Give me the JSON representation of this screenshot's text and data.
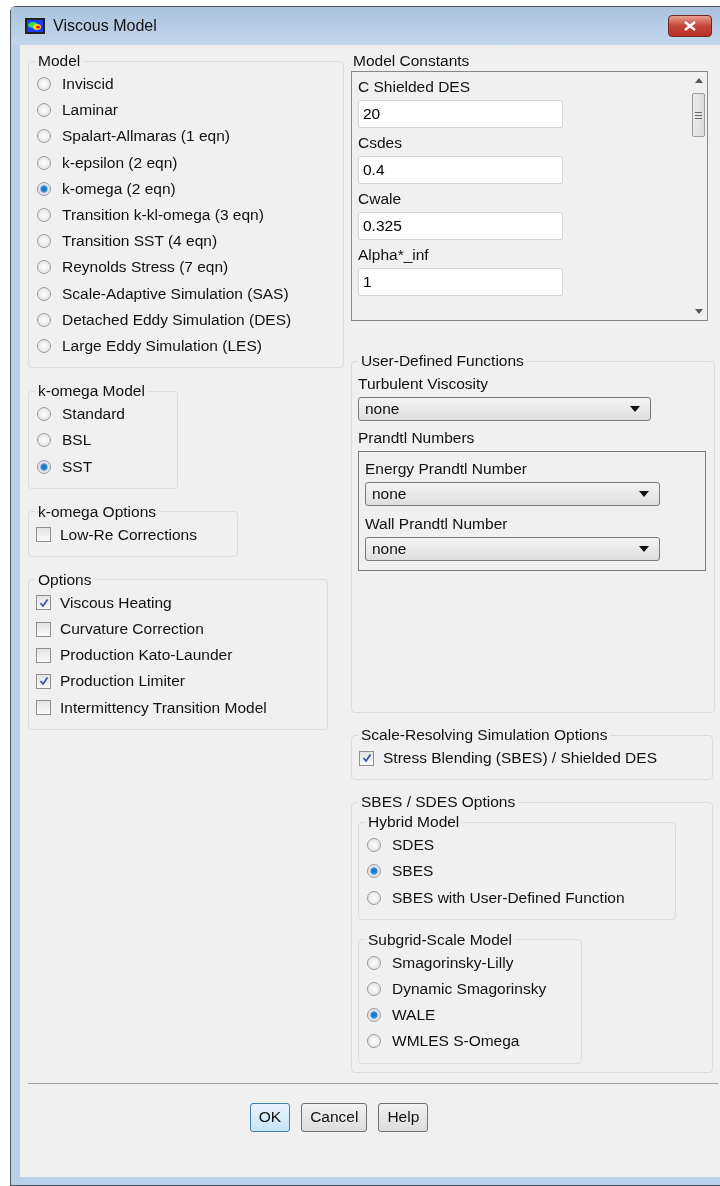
{
  "window": {
    "title": "Viscous Model"
  },
  "model": {
    "title": "Model",
    "options": [
      {
        "label": "Inviscid",
        "selected": false
      },
      {
        "label": "Laminar",
        "selected": false
      },
      {
        "label": "Spalart-Allmaras (1 eqn)",
        "selected": false
      },
      {
        "label": "k-epsilon (2 eqn)",
        "selected": false
      },
      {
        "label": "k-omega (2 eqn)",
        "selected": true
      },
      {
        "label": "Transition k-kl-omega (3 eqn)",
        "selected": false
      },
      {
        "label": "Transition SST (4 eqn)",
        "selected": false
      },
      {
        "label": "Reynolds Stress (7 eqn)",
        "selected": false
      },
      {
        "label": "Scale-Adaptive Simulation (SAS)",
        "selected": false
      },
      {
        "label": "Detached Eddy Simulation (DES)",
        "selected": false
      },
      {
        "label": "Large Eddy Simulation (LES)",
        "selected": false
      }
    ]
  },
  "komega_model": {
    "title": "k-omega Model",
    "options": [
      {
        "label": "Standard",
        "selected": false
      },
      {
        "label": "BSL",
        "selected": false
      },
      {
        "label": "SST",
        "selected": true
      }
    ]
  },
  "komega_options": {
    "title": "k-omega Options",
    "options": [
      {
        "label": "Low-Re Corrections",
        "checked": false
      }
    ]
  },
  "options": {
    "title": "Options",
    "options": [
      {
        "label": "Viscous Heating",
        "checked": true
      },
      {
        "label": "Curvature Correction",
        "checked": false
      },
      {
        "label": "Production Kato-Launder",
        "checked": false
      },
      {
        "label": "Production Limiter",
        "checked": true
      },
      {
        "label": "Intermittency Transition Model",
        "checked": false
      }
    ]
  },
  "model_constants": {
    "title": "Model Constants",
    "fields": [
      {
        "label": "C Shielded DES",
        "value": "20"
      },
      {
        "label": "Csdes",
        "value": "0.4"
      },
      {
        "label": "Cwale",
        "value": "0.325"
      },
      {
        "label": "Alpha*_inf",
        "value": "1"
      }
    ]
  },
  "udf": {
    "title": "User-Defined Functions",
    "turbulent_viscosity": {
      "label": "Turbulent Viscosity",
      "value": "none"
    },
    "prandtl": {
      "title": "Prandtl Numbers",
      "fields": [
        {
          "label": "Energy Prandtl Number",
          "value": "none"
        },
        {
          "label": "Wall Prandtl Number",
          "value": "none"
        }
      ]
    }
  },
  "scale_resolving": {
    "title": "Scale-Resolving Simulation Options",
    "options": [
      {
        "label": "Stress Blending (SBES) / Shielded DES",
        "checked": true
      }
    ]
  },
  "sbes": {
    "title": "SBES / SDES Options",
    "groups": [
      {
        "title": "Hybrid Model",
        "options": [
          {
            "label": "SDES",
            "selected": false
          },
          {
            "label": "SBES",
            "selected": true
          },
          {
            "label": "SBES with User-Defined Function",
            "selected": false
          }
        ]
      },
      {
        "title": "Subgrid-Scale Model",
        "options": [
          {
            "label": "Smagorinsky-Lilly",
            "selected": false
          },
          {
            "label": "Dynamic Smagorinsky",
            "selected": false
          },
          {
            "label": "WALE",
            "selected": true
          },
          {
            "label": "WMLES S-Omega",
            "selected": false
          }
        ]
      }
    ]
  },
  "buttons": [
    {
      "label": "OK",
      "default": true
    },
    {
      "label": "Cancel",
      "default": false
    },
    {
      "label": "Help",
      "default": false
    }
  ]
}
